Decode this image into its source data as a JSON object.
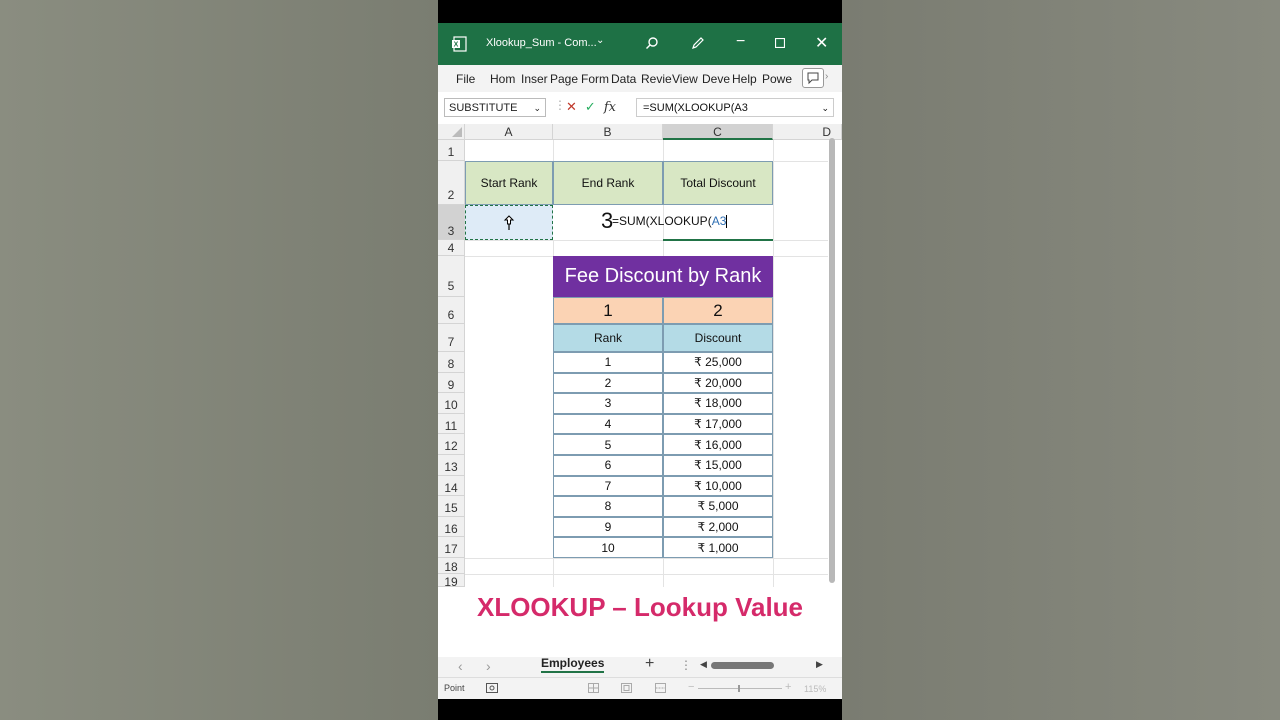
{
  "window": {
    "title": "Xlookup_Sum  -  Com...",
    "colors": {
      "title_bg": "#1e7145",
      "header_green": "#d8e7c4",
      "purple": "#7030a0",
      "peach": "#fbd3b4",
      "blue": "#b4dbe6",
      "caption": "#d52a6a"
    }
  },
  "ribbon": {
    "tabs": [
      "File",
      "Hom",
      "Inser",
      "Page",
      "Form",
      "Data",
      "Revie",
      "View",
      "Deve",
      "Help",
      "Powe"
    ]
  },
  "formula_bar": {
    "name_box": "SUBSTITUTE",
    "formula": "=SUM(XLOOKUP(A3"
  },
  "columns": [
    "A",
    "B",
    "C",
    "D"
  ],
  "rows": [
    "1",
    "2",
    "3",
    "4",
    "5",
    "6",
    "7",
    "8",
    "9",
    "10",
    "11",
    "12",
    "13",
    "14",
    "15",
    "16",
    "17",
    "18",
    "19"
  ],
  "header_table": {
    "start_rank": "Start Rank",
    "end_rank": "End Rank",
    "total_discount": "Total Discount",
    "b3_value": "3",
    "c3_formula_prefix": "=SUM(XLOOKUP(",
    "c3_formula_ref": "A3"
  },
  "fee_table": {
    "title": "Fee Discount by Rank",
    "index_1": "1",
    "index_2": "2",
    "col_rank": "Rank",
    "col_discount": "Discount",
    "rows": [
      {
        "rank": "1",
        "discount": "₹ 25,000"
      },
      {
        "rank": "2",
        "discount": "₹ 20,000"
      },
      {
        "rank": "3",
        "discount": "₹ 18,000"
      },
      {
        "rank": "4",
        "discount": "₹ 17,000"
      },
      {
        "rank": "5",
        "discount": "₹ 16,000"
      },
      {
        "rank": "6",
        "discount": "₹ 15,000"
      },
      {
        "rank": "7",
        "discount": "₹ 10,000"
      },
      {
        "rank": "8",
        "discount": "₹ 5,000"
      },
      {
        "rank": "9",
        "discount": "₹ 2,000"
      },
      {
        "rank": "10",
        "discount": "₹ 1,000"
      }
    ]
  },
  "caption": "XLOOKUP – Lookup Value",
  "sheet_tabs": {
    "active": "Employees"
  },
  "status": {
    "mode": "Point",
    "zoom": "115%"
  }
}
